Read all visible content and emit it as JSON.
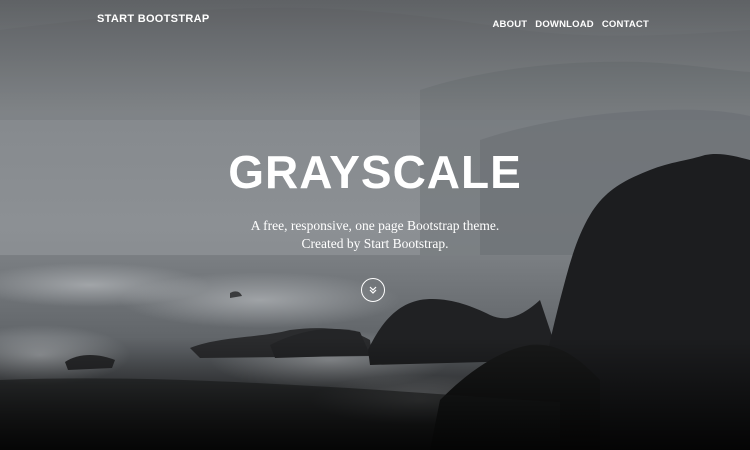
{
  "navbar": {
    "brand": "START BOOTSTRAP",
    "links": [
      {
        "label": "ABOUT"
      },
      {
        "label": "DOWNLOAD"
      },
      {
        "label": "CONTACT"
      }
    ]
  },
  "hero": {
    "title": "GRAYSCALE",
    "intro_line1": "A free, responsive, one page Bootstrap theme.",
    "intro_line2": "Created by Start Bootstrap.",
    "scroll_icon": "double-chevron-down-icon"
  },
  "colors": {
    "text": "#ffffff",
    "sky": "#8a8e92",
    "sea": "#6b6f73",
    "rock": "#1c1d1f"
  }
}
